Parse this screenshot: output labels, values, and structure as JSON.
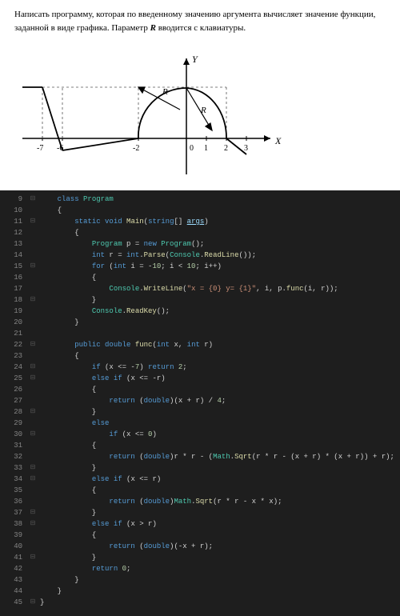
{
  "problem": {
    "text_prefix": "Написать программу, которая по введенному значению аргумента вычисляет значение функции, заданной в виде графика. Параметр ",
    "param": "R",
    "text_suffix": " вводится с клавиатуры."
  },
  "graph": {
    "x_ticks": [
      "-7",
      "-6",
      "-2",
      "0",
      "1",
      "2",
      "3"
    ],
    "x_label": "X",
    "y_label": "Y",
    "annotations": [
      "R",
      "R"
    ]
  },
  "code": {
    "lines": [
      {
        "n": 9,
        "fold": "⊟",
        "html": "    <span class='kw'>class</span> <span class='cls'>Program</span>"
      },
      {
        "n": 10,
        "fold": "",
        "html": "    {"
      },
      {
        "n": 11,
        "fold": "⊟",
        "html": "        <span class='kw'>static</span> <span class='kw'>void</span> <span class='fn'>Main</span>(<span class='kw'>string</span>[] <span class='var param'>args</span>)"
      },
      {
        "n": 12,
        "fold": "",
        "html": "        {"
      },
      {
        "n": 13,
        "fold": "",
        "html": "            <span class='cls'>Program</span> p = <span class='kw'>new</span> <span class='cls'>Program</span>();"
      },
      {
        "n": 14,
        "fold": "",
        "html": "            <span class='kw'>int</span> r = <span class='kw'>int</span>.<span class='fn'>Parse</span>(<span class='cls'>Console</span>.<span class='fn'>ReadLine</span>());"
      },
      {
        "n": 15,
        "fold": "⊟",
        "html": "            <span class='kw'>for</span> (<span class='kw'>int</span> i = -<span class='num'>10</span>; i &lt; <span class='num'>10</span>; i++)"
      },
      {
        "n": 16,
        "fold": "",
        "html": "            {"
      },
      {
        "n": 17,
        "fold": "",
        "html": "                <span class='cls'>Console</span>.<span class='fn'>WriteLine</span>(<span class='str'>\"x = {0} y= {1}\"</span>, i, p.<span class='fn'>func</span>(i, r));"
      },
      {
        "n": 18,
        "fold": "⊟",
        "html": "            }"
      },
      {
        "n": 19,
        "fold": "",
        "html": "            <span class='cls'>Console</span>.<span class='fn'>ReadKey</span>();"
      },
      {
        "n": 20,
        "fold": "",
        "html": "        }"
      },
      {
        "n": 21,
        "fold": "",
        "html": ""
      },
      {
        "n": 22,
        "fold": "⊟",
        "html": "        <span class='kw'>public</span> <span class='kw'>double</span> <span class='fn'>func</span>(<span class='kw'>int</span> x, <span class='kw'>int</span> r)"
      },
      {
        "n": 23,
        "fold": "",
        "html": "        {"
      },
      {
        "n": 24,
        "fold": "⊟",
        "html": "            <span class='kw'>if</span> (x &lt;= -<span class='num'>7</span>) <span class='kw'>return</span> <span class='num'>2</span>;"
      },
      {
        "n": 25,
        "fold": "⊟",
        "html": "            <span class='kw'>else</span> <span class='kw'>if</span> (x &lt;= -r)"
      },
      {
        "n": 26,
        "fold": "",
        "html": "            {"
      },
      {
        "n": 27,
        "fold": "",
        "html": "                <span class='kw'>return</span> (<span class='kw'>double</span>)(x + r) / <span class='num'>4</span>;"
      },
      {
        "n": 28,
        "fold": "⊟",
        "html": "            }"
      },
      {
        "n": 29,
        "fold": "",
        "html": "            <span class='kw'>else</span>"
      },
      {
        "n": 30,
        "fold": "⊟",
        "html": "                <span class='kw'>if</span> (x &lt;= <span class='num'>0</span>)"
      },
      {
        "n": 31,
        "fold": "",
        "html": "            {"
      },
      {
        "n": 32,
        "fold": "",
        "html": "                <span class='kw'>return</span> (<span class='kw'>double</span>)r * r - (<span class='cls'>Math</span>.<span class='fn'>Sqrt</span>(r * r - (x + r) * (x + r)) + r);"
      },
      {
        "n": 33,
        "fold": "⊟",
        "html": "            }"
      },
      {
        "n": 34,
        "fold": "⊟",
        "html": "            <span class='kw'>else</span> <span class='kw'>if</span> (x &lt;= r)"
      },
      {
        "n": 35,
        "fold": "",
        "html": "            {"
      },
      {
        "n": 36,
        "fold": "",
        "html": "                <span class='kw'>return</span> (<span class='kw'>double</span>)<span class='cls'>Math</span>.<span class='fn'>Sqrt</span>(r * r - x * x);"
      },
      {
        "n": 37,
        "fold": "⊟",
        "html": "            }"
      },
      {
        "n": 38,
        "fold": "⊟",
        "html": "            <span class='kw'>else</span> <span class='kw'>if</span> (x &gt; r)"
      },
      {
        "n": 39,
        "fold": "",
        "html": "            {"
      },
      {
        "n": 40,
        "fold": "",
        "html": "                <span class='kw'>return</span> (<span class='kw'>double</span>)(-x + r);"
      },
      {
        "n": 41,
        "fold": "⊟",
        "html": "            }"
      },
      {
        "n": 42,
        "fold": "",
        "html": "            <span class='kw'>return</span> <span class='num'>0</span>;"
      },
      {
        "n": 43,
        "fold": "",
        "html": "        }"
      },
      {
        "n": 44,
        "fold": "",
        "html": "    }"
      },
      {
        "n": 45,
        "fold": "⊟",
        "html": "}"
      }
    ]
  }
}
